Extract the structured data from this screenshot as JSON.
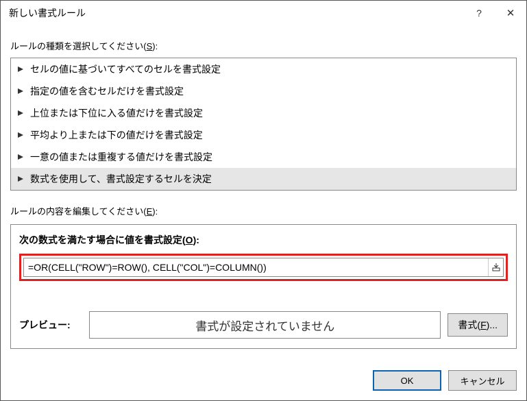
{
  "dialog": {
    "title": "新しい書式ルール"
  },
  "titlebar": {
    "help": "?",
    "close": "✕"
  },
  "sections": {
    "rule_type_label_pre": "ルールの種類を選択してください(",
    "rule_type_key": "S",
    "rule_type_label_post": "):",
    "rule_edit_label_pre": "ルールの内容を編集してください(",
    "rule_edit_key": "E",
    "rule_edit_label_post": "):"
  },
  "rule_types": {
    "items": {
      "0": {
        "label": "セルの値に基づいてすべてのセルを書式設定"
      },
      "1": {
        "label": "指定の値を含むセルだけを書式設定"
      },
      "2": {
        "label": "上位または下位に入る値だけを書式設定"
      },
      "3": {
        "label": "平均より上または下の値だけを書式設定"
      },
      "4": {
        "label": "一意の値または重複する値だけを書式設定"
      },
      "5": {
        "label": "数式を使用して、書式設定するセルを決定"
      }
    },
    "selected_index": 5
  },
  "formula": {
    "label_pre": "次の数式を満たす場合に値を書式設定(",
    "label_key": "O",
    "label_post": "):",
    "value": "=OR(CELL(\"ROW\")=ROW(), CELL(\"COL\")=COLUMN())"
  },
  "preview": {
    "label": "プレビュー:",
    "text": "書式が設定されていません",
    "format_btn_pre": "書式(",
    "format_btn_key": "F",
    "format_btn_post": ")..."
  },
  "footer": {
    "ok": "OK",
    "cancel": "キャンセル"
  }
}
